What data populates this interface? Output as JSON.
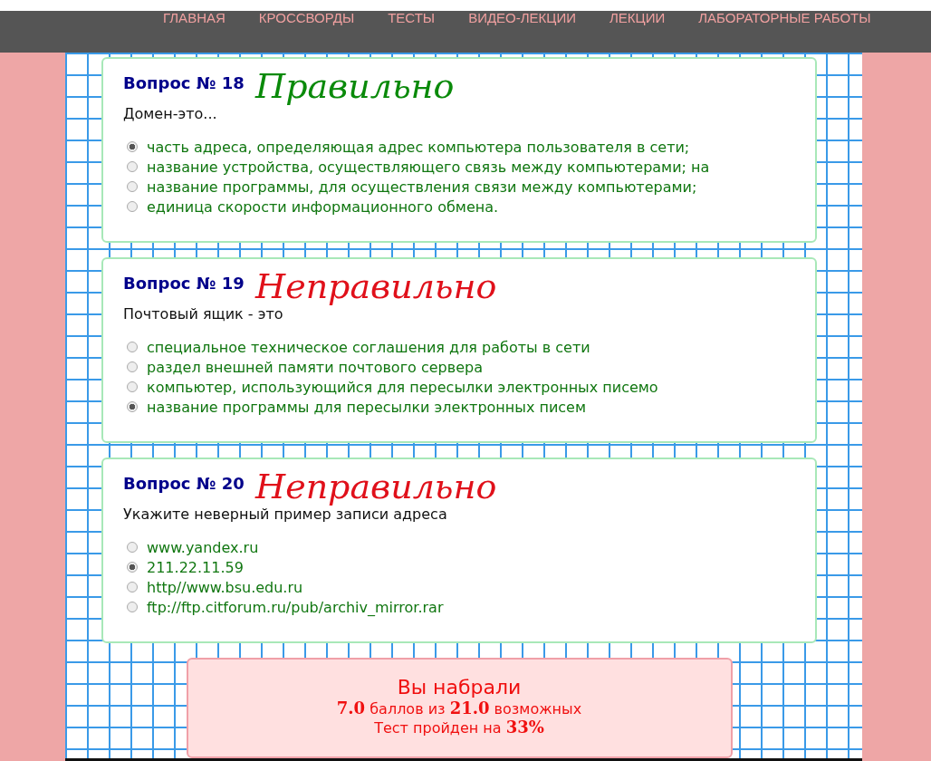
{
  "nav": [
    {
      "label": "ГЛАВНАЯ"
    },
    {
      "label": "КРОССВОРДЫ"
    },
    {
      "label": "ТЕСТЫ"
    },
    {
      "label": "ВИДЕО-ЛЕКЦИИ"
    },
    {
      "label": "ЛЕКЦИИ"
    },
    {
      "label": "ЛАБОРАТОРНЫЕ РАБОТЫ"
    }
  ],
  "questions": [
    {
      "title": "Вопрос № 18",
      "verdict": {
        "kind": "correct",
        "text": "Правильно"
      },
      "text": "Домен-это...",
      "options": [
        {
          "label": "часть адреса, определяющая адрес компьютера пользователя в сети;",
          "selected": true
        },
        {
          "label": "название устройства, осуществляющего связь между компьютерами; на",
          "selected": false
        },
        {
          "label": "название программы, для осуществления связи между компьютерами;",
          "selected": false
        },
        {
          "label": "единица скорости информационного обмена.",
          "selected": false
        }
      ]
    },
    {
      "title": "Вопрос № 19",
      "verdict": {
        "kind": "incorrect",
        "text": "Неправильно"
      },
      "text": "Почтовый ящик - это",
      "options": [
        {
          "label": "специальное техническое соглашения для работы в сети",
          "selected": false
        },
        {
          "label": "раздел внешней памяти почтового сервера",
          "selected": false
        },
        {
          "label": "компьютер, использующийся для пересылки электронных писемо",
          "selected": false
        },
        {
          "label": "название программы для пересылки электронных писем",
          "selected": true
        }
      ]
    },
    {
      "title": "Вопрос № 20",
      "verdict": {
        "kind": "incorrect",
        "text": "Неправильно"
      },
      "text": "Укажите неверный пример записи адреса",
      "options": [
        {
          "label": "www.yandex.ru",
          "selected": false
        },
        {
          "label": "211.22.11.59",
          "selected": true
        },
        {
          "label": "http//www.bsu.edu.ru",
          "selected": false
        },
        {
          "label": "ftp://ftp.citforum.ru/pub/archiv_mirror.rar",
          "selected": false
        }
      ]
    }
  ],
  "result": {
    "heading": "Вы набрали",
    "score": "**7.0** баллов из **21.0** возможных",
    "passed": "Тест пройден на **33%**"
  }
}
